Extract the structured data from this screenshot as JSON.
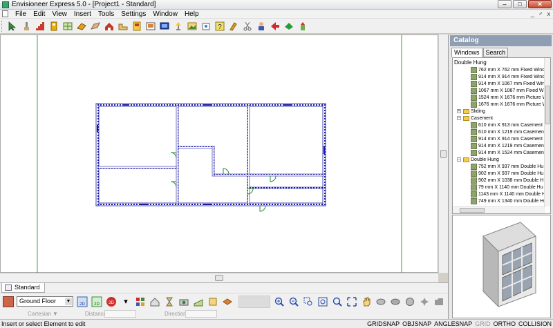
{
  "window": {
    "title": "Envisioneer Express 5.0 - [Project1 - Standard]",
    "minimize": "–",
    "maximize": "□",
    "close": "✕"
  },
  "menu": {
    "items": [
      "File",
      "Edit",
      "View",
      "Insert",
      "Tools",
      "Settings",
      "Window",
      "Help"
    ],
    "mdi_minimize": "_",
    "mdi_restore": "♂",
    "mdi_close": "x"
  },
  "toolbar_icons": [
    "select-arrow-icon",
    "brush-icon",
    "stairs-icon",
    "door-icon",
    "window-icon",
    "roof-icon",
    "chimney-icon",
    "deck-icon",
    "cabinet-icon",
    "appliance-icon",
    "furniture-icon",
    "electrical-icon",
    "lamp-icon",
    "landscape-icon",
    "help-icon",
    "tool-icon",
    "scissors-icon",
    "person-icon",
    "arrow-icon",
    "plant-icon",
    "move-icon"
  ],
  "view_tab": {
    "label": "Standard"
  },
  "floor": {
    "selected": "Ground Floor"
  },
  "bottom_buttons": [
    "2D",
    "2D",
    "3D"
  ],
  "coord": {
    "mode": "Cartesian",
    "distance_label": "Distance",
    "direction_label": "Direction"
  },
  "status": {
    "left": "Insert or select Element to edit",
    "snaps": [
      "GRIDSNAP",
      "OBJSNAP",
      "ANGLESNAP",
      "GRID",
      "ORTHO",
      "COLLISION"
    ],
    "dim_snaps": [
      "GRID"
    ]
  },
  "catalog": {
    "title": "Catalog",
    "tabs": [
      "Windows",
      "Search"
    ],
    "root": "Double Hung",
    "items": [
      {
        "type": "item",
        "label": "762 mm X 762 mm Fixed Wind"
      },
      {
        "type": "item",
        "label": "914 mm X 914 mm Fixed Wind"
      },
      {
        "type": "item",
        "label": "914 mm X 1067 mm Fixed Win"
      },
      {
        "type": "item",
        "label": "1067 mm X 1067 mm Fixed W"
      },
      {
        "type": "item",
        "label": "1524 mm X 1676 mm Picture W"
      },
      {
        "type": "item",
        "label": "1676 mm X 1676 mm Picture W"
      },
      {
        "type": "folder",
        "label": "Sliding",
        "expanded": false
      },
      {
        "type": "folder",
        "label": "Casement",
        "expanded": true
      },
      {
        "type": "item",
        "label": "610 mm X 913 mm Casement"
      },
      {
        "type": "item",
        "label": "610 mm X 1219 mm Casemen"
      },
      {
        "type": "item",
        "label": "914 mm  X 914 mm Casement"
      },
      {
        "type": "item",
        "label": "914 mm X 1219 mm Casemen"
      },
      {
        "type": "item",
        "label": "914 mm X 1524 mm Casemen"
      },
      {
        "type": "folder",
        "label": "Double Hung",
        "expanded": true
      },
      {
        "type": "item",
        "label": "752 mm X 937 mm Double Hu"
      },
      {
        "type": "item",
        "label": "902 mm X 937 mm Double Hu"
      },
      {
        "type": "item",
        "label": "902 mm X 1038 mm Double H"
      },
      {
        "type": "item",
        "label": "79 mm X 1140 mm Double Hu"
      },
      {
        "type": "item",
        "label": "1143 mm X 1140 mm Double H"
      },
      {
        "type": "item",
        "label": "749 mm X 1340 mm Double Hu"
      }
    ]
  },
  "colors": {
    "wall": "#1a1aa0",
    "door": "#2a8a2a",
    "guide": "#3aa03a",
    "catalog_header": "#8f9eb3"
  }
}
